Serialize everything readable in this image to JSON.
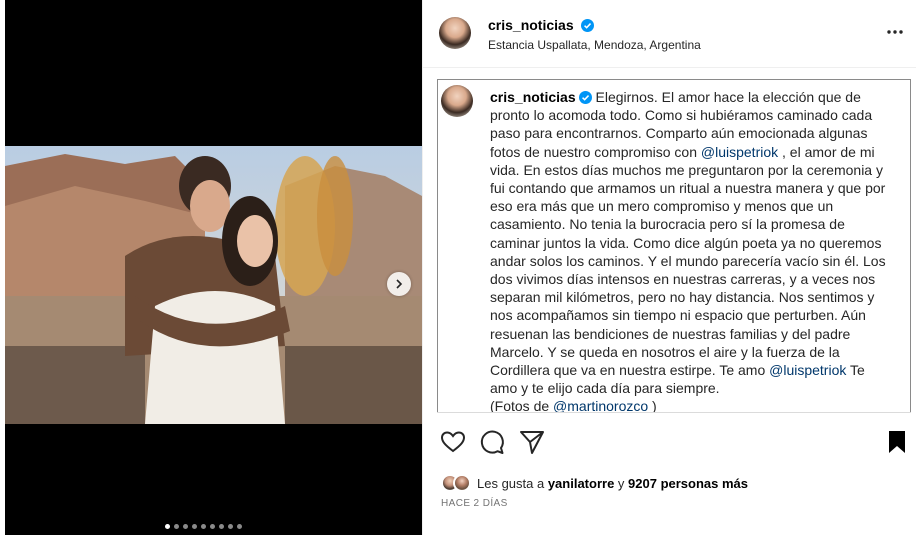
{
  "post": {
    "username": "cris_noticias",
    "location": "Estancia Uspallata, Mendoza, Argentina",
    "caption": {
      "username": "cris_noticias",
      "part1": "Elegirnos. El amor hace la elección que de pronto lo acomoda todo. Como si hubiéramos caminado cada paso para encontrarnos. Comparto aún emocionada algunas fotos de nuestro compromiso con ",
      "mention1": "@luispetriok",
      "part2": " , el amor de mi vida. En estos días muchos me preguntaron por la ceremonia y fui contando que armamos un ritual a nuestra manera y que por eso era más que un mero compromiso y menos que un casamiento. No tenia la burocracia pero sí la promesa de caminar juntos la vida. Como dice algún poeta ya no queremos andar solos los caminos. Y el mundo parecería vacío sin él. Los dos vivimos días intensos en nuestras carreras, y a veces nos separan mil kilómetros, pero no hay distancia. Nos sentimos y nos acompañamos sin tiempo ni espacio que perturben. Aún resuenan las bendiciones de nuestras familias y del padre Marcelo. Y se queda en nosotros el aire y la fuerza de la Cordillera que va en nuestra estirpe. Te amo ",
      "mention2": "@luispetriok",
      "part3": " Te amo y te elijo cada día para siempre.",
      "photos_prefix": "(Fotos de ",
      "mention3": "@martinorozco",
      "photos_suffix": " )"
    },
    "likes": {
      "prefix": "Les gusta a ",
      "user": "yanilatorre",
      "middle": " y ",
      "count": "9207 personas más"
    },
    "time": "HACE 2 DÍAS",
    "carousel": {
      "total": 9,
      "active": 0
    }
  },
  "icons": {
    "verified": "verified-badge-icon",
    "more": "more-options-icon",
    "like": "heart-icon",
    "comment": "comment-icon",
    "share": "send-icon",
    "save": "bookmark-icon",
    "next": "chevron-right-icon"
  },
  "colors": {
    "verified": "#0095f6",
    "mention": "#00376b"
  }
}
